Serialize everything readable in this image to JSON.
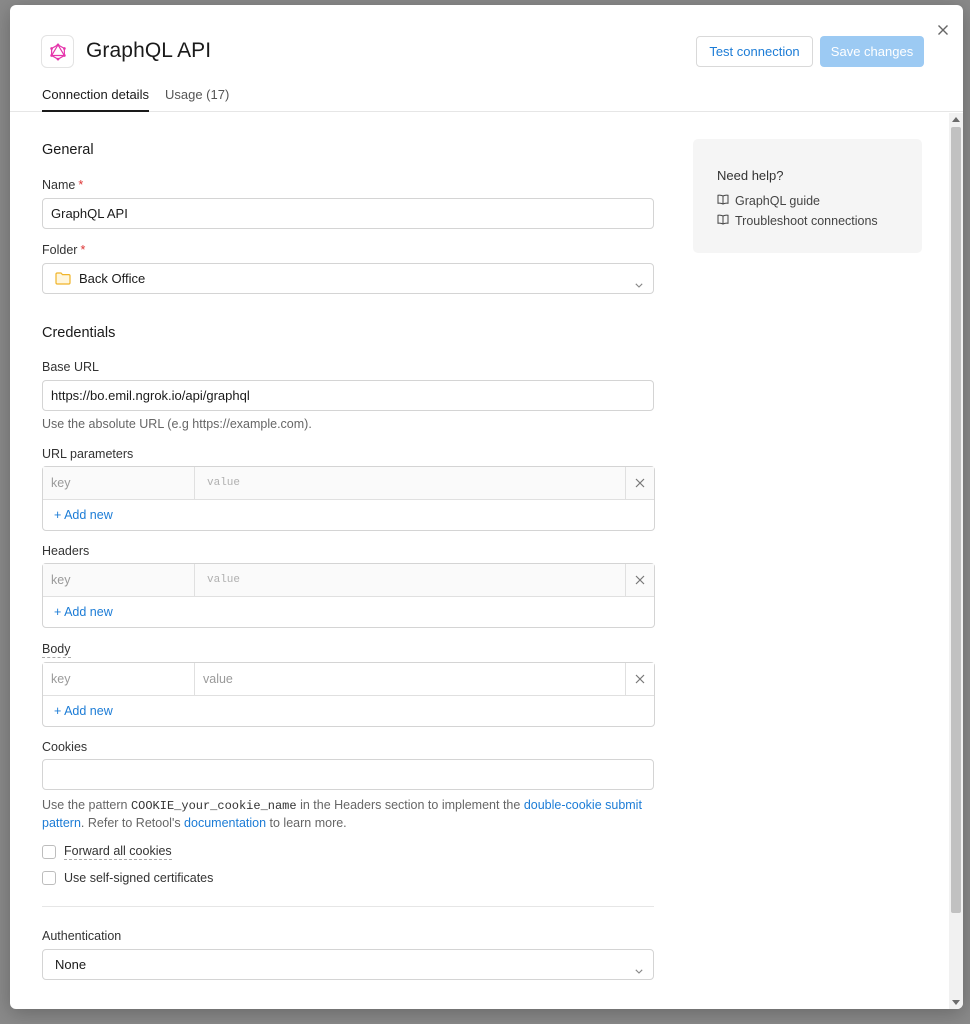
{
  "header": {
    "title": "GraphQL API",
    "test_label": "Test connection",
    "save_label": "Save changes"
  },
  "tabs": [
    {
      "label": "Connection details",
      "active": true
    },
    {
      "label": "Usage (17)",
      "active": false
    }
  ],
  "general": {
    "title": "General",
    "name_label": "Name",
    "required_mark": "*",
    "name_value": "GraphQL API",
    "folder_label": "Folder",
    "folder_value": "Back Office"
  },
  "credentials": {
    "title": "Credentials",
    "base_url_label": "Base URL",
    "base_url_value": "https://bo.emil.ngrok.io/api/graphql",
    "base_url_help": "Use the absolute URL (e.g https://example.com).",
    "url_params": {
      "label": "URL parameters",
      "key_placeholder": "key",
      "value_placeholder": "value",
      "add_label": "+ Add new"
    },
    "headers": {
      "label": "Headers",
      "key_placeholder": "key",
      "value_placeholder": "value",
      "add_label": "+ Add new"
    },
    "body": {
      "label": "Body",
      "key_placeholder": "key",
      "value_placeholder": "value",
      "add_label": "+ Add new"
    },
    "cookies_label": "Cookies",
    "cookies_value": "",
    "cookies_help": {
      "pre": "Use the pattern ",
      "code": "COOKIE_your_cookie_name",
      "mid": " in the Headers section to implement the ",
      "link1": "double-cookie submit pattern",
      "mid2": ". Refer to Retool's ",
      "link2": "documentation",
      "post": " to learn more."
    },
    "forward_cookies_label": "Forward all cookies",
    "self_signed_label": "Use self-signed certificates"
  },
  "authentication": {
    "label": "Authentication",
    "value": "None"
  },
  "help": {
    "title": "Need help?",
    "links": [
      "GraphQL guide",
      "Troubleshoot connections"
    ]
  },
  "colors": {
    "accent": "#1c7cd6",
    "save_disabled": "#9ccaf3",
    "graphql_pink": "#e535ab",
    "folder_yellow": "#f0b429"
  },
  "icons": {
    "logo": "graphql-icon",
    "close": "close-icon",
    "folder": "folder-icon",
    "chevron": "chevron-down-icon",
    "book": "book-icon",
    "delete": "close-icon"
  }
}
